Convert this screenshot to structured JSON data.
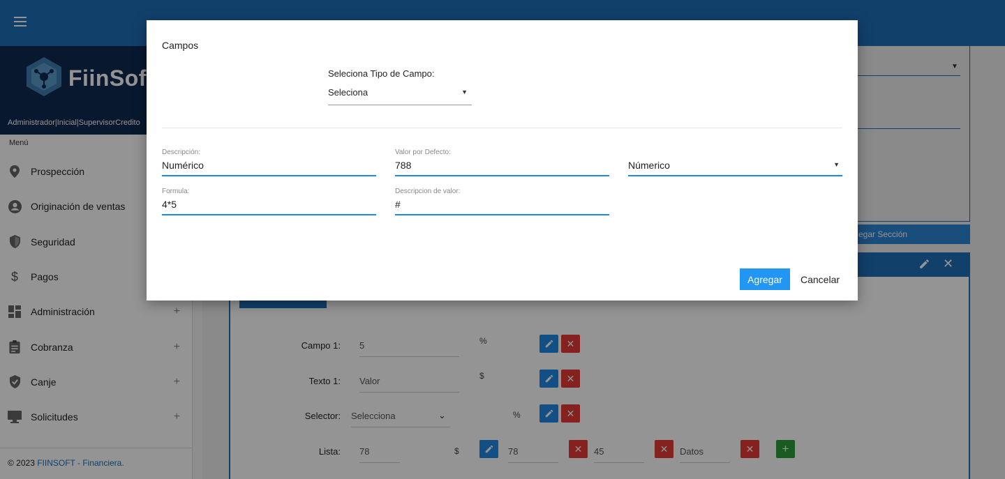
{
  "app": {
    "brand_name": "FiinSof",
    "role_line": "Administrador|Inicial|SupervisorCredito",
    "menu_label": "Menú",
    "footer_prefix": "© 2023",
    "footer_link": "FIINSOFT - Financiera."
  },
  "sidebar": {
    "items": [
      {
        "label": "Prospección",
        "icon": "location-pin-icon",
        "plus": ""
      },
      {
        "label": "Originación de ventas",
        "icon": "account-circle-icon",
        "plus": ""
      },
      {
        "label": "Seguridad",
        "icon": "shield-icon",
        "plus": ""
      },
      {
        "label": "Pagos",
        "icon": "dollar-icon",
        "plus": ""
      },
      {
        "label": "Administración",
        "icon": "dashboard-icon",
        "plus": "+"
      },
      {
        "label": "Cobranza",
        "icon": "clipboard-icon",
        "plus": "+"
      },
      {
        "label": "Canje",
        "icon": "verified-shield-icon",
        "plus": "+"
      },
      {
        "label": "Solicitudes",
        "icon": "monitor-icon",
        "plus": "+"
      }
    ]
  },
  "background": {
    "add_section_label": "egar Sección",
    "rows": [
      {
        "label": "Campo 1:",
        "value": "5",
        "unit": "%"
      },
      {
        "label": "Texto 1:",
        "value": "Valor",
        "unit": "$"
      },
      {
        "label": "Selector:",
        "value": "Selecciona",
        "unit": "%"
      },
      {
        "label": "Lista:",
        "value": "78",
        "unit": "$",
        "items": [
          "78",
          "45",
          "Datos"
        ]
      }
    ]
  },
  "modal": {
    "title": "Campos",
    "type_label": "Seleciona Tipo de Campo:",
    "type_value": "Seleciona",
    "fields": {
      "descripcion": {
        "label": "Descripción:",
        "value": "Numérico"
      },
      "valor_defecto": {
        "label": "Valor por Defecto:",
        "value": "788"
      },
      "tipo": {
        "value": "Númerico"
      },
      "formula": {
        "label": "Formula:",
        "value": "4*5"
      },
      "descripcion_valor": {
        "label": "Descripcion de valor:",
        "value": "#"
      }
    },
    "agregar_label": "Agregar",
    "cancelar_label": "Cancelar"
  },
  "colors": {
    "primary": "#1e6fb8",
    "accent": "#2196f3",
    "danger": "#e53935",
    "success": "#2e9e3a"
  }
}
